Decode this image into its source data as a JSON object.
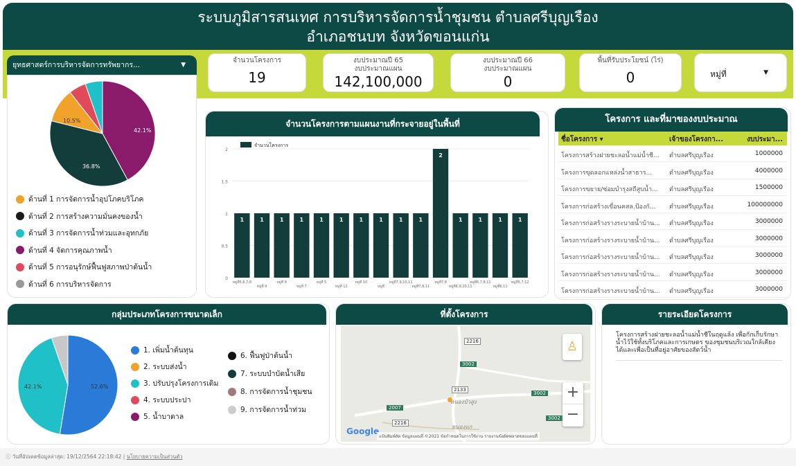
{
  "title": {
    "line1": "ระบบภูมิสารสนเทศ การบริหารจัดการน้ำชุมชน ตำบลศรีบุญเรือง",
    "line2": "อำเภอชนบท จังหวัดขอนแก่น"
  },
  "strategy_filter": {
    "label": "ยุทธศาสตร์การบริหารจัดการทรัพยากร..."
  },
  "kpis": [
    {
      "label": "จำนวนโครงการ",
      "label2": "",
      "value": "19"
    },
    {
      "label": "งบประมาณปี 65",
      "label2": "งบประมาณแผน",
      "value": "142,100,000"
    },
    {
      "label": "งบประมาณปี 66",
      "label2": "งบประมาณแผน",
      "value": "0"
    },
    {
      "label": "พื้นที่รับประโยชน์ (ไร่)",
      "label2": "",
      "value": "0"
    }
  ],
  "village_filter": {
    "label": "หมู่ที่"
  },
  "pie1": {
    "labels": [
      "10.5%",
      "42.1%",
      "36.8%"
    ],
    "slices": [
      {
        "pct": 42.1,
        "color": "#8a1a6a"
      },
      {
        "pct": 36.8,
        "color": "#123d3a"
      },
      {
        "pct": 10.5,
        "color": "#f0a22a"
      },
      {
        "pct": 5.3,
        "color": "#e04a5a"
      },
      {
        "pct": 5.3,
        "color": "#20c0c8"
      }
    ]
  },
  "pie1_legend": [
    {
      "label": "ด้านที่ 1 การจัดการน้ำอุปโภคบริโภค",
      "color": "#f0a22a"
    },
    {
      "label": "ด้านที่ 2 การสร้างความมั่นคงของน้ำ",
      "color": "#1a1a1a"
    },
    {
      "label": "ด้านที่ 3 การจัดการน้ำท่วมและอุทกภัย",
      "color": "#20c0c8"
    },
    {
      "label": "ด้านที่ 4 จัดการคุณภาพน้ำ",
      "color": "#8a1a6a"
    },
    {
      "label": "ด้านที่ 5 การอนุรักษ์ฟื้นฟูสภาพป่าต้นน้ำ",
      "color": "#e04a5a"
    },
    {
      "label": "ด้านที่ 6 การบริหารจัดการ",
      "color": "#999999"
    }
  ],
  "bar_panel": {
    "title": "จำนวนโครงการตามแผนงานที่กระจายอยู่ในพื้นที่",
    "legend": "จำนวนโครงการ"
  },
  "chart_data": {
    "type": "bar",
    "series": [
      {
        "name": "จำนวนโครงการ",
        "values": [
          1,
          1,
          1,
          1,
          1,
          1,
          1,
          1,
          1,
          1,
          2,
          1,
          1,
          1,
          1
        ]
      }
    ],
    "categories": [
      "หมู่ที่5,6,7,8",
      "หมู่ที่ 9",
      "หมู่ที่ 8",
      "หมู่ที่ 7",
      "หมู่ที่ 5",
      "หมู่ที่ 12",
      "หมู่ที่ 10",
      "หมู่ที่",
      "หมู่ที่7,9,10,11",
      "หมู่ที่7,8,11",
      "หมู่ที่7,8",
      "หมู่ที่6,9,10,11",
      "หมู่ที่6,7,8,11",
      "หมู่ที่6,11",
      "หมู่ที่5,7,12"
    ],
    "ylim": [
      0,
      2
    ],
    "yticks": [
      "0",
      "0.5",
      "1",
      "1.5",
      "2"
    ]
  },
  "table": {
    "title": "โครงการ และที่มาของงบประมาณ",
    "headers": [
      "ชื่อโครงการ ▾",
      "เจ้าของโครงกา...",
      "งบประมา..."
    ],
    "rows": [
      [
        "โครงการสร้างฝายชะลอน้ำแม่น้ำชี...",
        "ตำบลศรีบุญเรือง",
        "1000000"
      ],
      [
        "โครงการขุดลอกแหล่งน้ำสาธาร...",
        "ตำบลศรีบุญเรือง",
        "4000000"
      ],
      [
        "โครงการขยาย/ซ่อมบำรุงสถีสูบน้ำ...",
        "ตำบลศรีบุญเรือง",
        "1500000"
      ],
      [
        "โครงการก่อสร้างเขื่อนคสล.ป้องกั...",
        "ตำบลศรีบุญเรือง",
        "100000000"
      ],
      [
        "โครงการก่อสร้างรางระบายน้ำบ้าน...",
        "ตำบลศรีบุญเรือง",
        "3000000"
      ],
      [
        "โครงการก่อสร้างรางระบายน้ำบ้าน...",
        "ตำบลศรีบุญเรือง",
        "3000000"
      ],
      [
        "โครงการก่อสร้างรางระบายน้ำบ้าน...",
        "ตำบลศรีบุญเรือง",
        "3000000"
      ],
      [
        "โครงการก่อสร้างรางระบายน้ำบ้าน...",
        "ตำบลศรีบุญเรือง",
        "3000000"
      ],
      [
        "โครงการก่อสร้างรางระบายน้ำบ้าน...",
        "ตำบลศรีบุญเรือง",
        "3000000"
      ]
    ]
  },
  "small_projects": {
    "title": "กลุ่มประเภทโครงการขนาดเล็ก",
    "pie_labels": [
      "42.1%",
      "52.6%"
    ],
    "slices": [
      {
        "pct": 52.6,
        "color": "#2a7ad8"
      },
      {
        "pct": 42.1,
        "color": "#20c0c8"
      },
      {
        "pct": 5.3,
        "color": "#c8c8c8"
      }
    ],
    "legend_col1": [
      {
        "label": "1. เพิ่มน้ำต้นทุน",
        "color": "#2a7ad8"
      },
      {
        "label": "2. ระบบส่งน้ำ",
        "color": "#f0a22a"
      },
      {
        "label": "3. ปรับปรุงโครงการเดิม",
        "color": "#20c0c8"
      },
      {
        "label": "4. ระบบประปา",
        "color": "#e04a5a"
      },
      {
        "label": "5. น้ำบาดาล",
        "color": "#8a1a6a"
      }
    ],
    "legend_col2": [
      {
        "label": "6. ฟื้นฟูป่าต้นน้ำ",
        "color": "#111111"
      },
      {
        "label": "7. ระบบบำบัดน้ำเสีย",
        "color": "#123d3a"
      },
      {
        "label": "8. การจัดการน้ำชุมชน",
        "color": "#a07a7a"
      },
      {
        "label": "9. การจัดการน้ำท่วม",
        "color": "#cccccc"
      }
    ]
  },
  "map": {
    "title": "ที่ตั้งโครงการ",
    "roads": [
      "2216",
      "3002",
      "2133",
      "3002",
      "2007",
      "2216",
      "3002"
    ],
    "places": [
      "หนองบัวสูง",
      "หนองแก"
    ],
    "zoom_in": "+",
    "zoom_out": "−",
    "brand": "Google",
    "attribution": "แป้นพิมพ์ลัด   ข้อมูลแผนที่ ©2021   ข้อกำหนดในการใช้งาน   รายงานข้อผิดพลาดของแผนที่"
  },
  "details": {
    "title": "รายระเอียดโครงการ",
    "text": "โครงการสร้างฝายชะลอน้ำแม่น้ำชีในฤดูแล้ง เพื่อกักเก็บรักษาน้ำไว้ใช้ทั้งบริโภคและการเกษตร ของชุมชนบริเวณใกล้เคียงได้และเพื่อเป็นที่อยู่อาศัยของสัตว์น้ำ"
  },
  "footer": {
    "updated": "วันที่อัปเดตข้อมูลล่าสุด: 19/12/2564 22:18:42",
    "privacy": "นโยบายความเป็นส่วนตัว"
  }
}
